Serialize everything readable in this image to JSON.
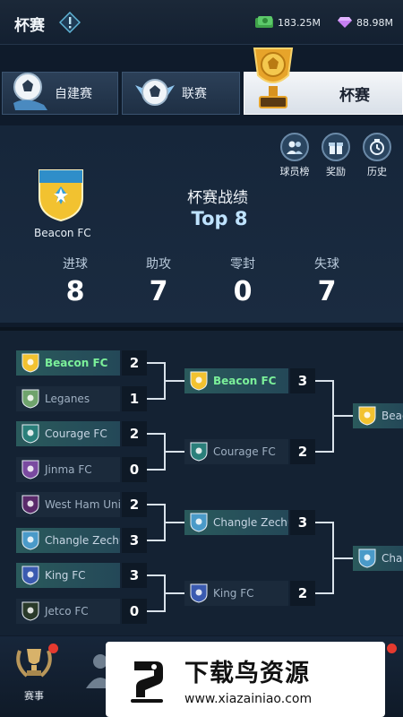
{
  "header": {
    "title": "杯赛",
    "money": "183.25M",
    "gems": "88.98M"
  },
  "tabs": [
    {
      "label": "自建赛",
      "icon": "ball-hand-icon"
    },
    {
      "label": "联赛",
      "icon": "ball-wings-icon"
    },
    {
      "label": "杯赛",
      "icon": "trophy-icon",
      "active": true
    }
  ],
  "quick_links": [
    {
      "label": "球员榜",
      "icon": "players-icon"
    },
    {
      "label": "奖励",
      "icon": "gift-icon"
    },
    {
      "label": "历史",
      "icon": "history-icon"
    }
  ],
  "record": {
    "team": "Beacon FC",
    "title": "杯赛战绩",
    "rank": "Top 8"
  },
  "stats": [
    {
      "label": "进球",
      "value": "8"
    },
    {
      "label": "助攻",
      "value": "7"
    },
    {
      "label": "零封",
      "value": "0"
    },
    {
      "label": "失球",
      "value": "7"
    }
  ],
  "bracket": {
    "round1": [
      {
        "team": "Beacon FC",
        "score": "2",
        "result": "win",
        "crest": "#f2c230"
      },
      {
        "team": "Leganes",
        "score": "1",
        "result": "lose",
        "crest": "#6fa36c"
      },
      {
        "team": "Courage FC",
        "score": "2",
        "result": "win",
        "crest": "#2a7f7a"
      },
      {
        "team": "Jinma FC",
        "score": "0",
        "result": "lose",
        "crest": "#7a4aa0"
      },
      {
        "team": "West Ham United",
        "score": "2",
        "result": "lose",
        "crest": "#5a2a6a"
      },
      {
        "team": "Changle Zechuan FC",
        "score": "3",
        "result": "win",
        "crest": "#4a9ac8"
      },
      {
        "team": "King FC",
        "score": "3",
        "result": "win",
        "crest": "#3a5ab0"
      },
      {
        "team": "Jetco FC",
        "score": "0",
        "result": "lose",
        "crest": "#2a3a2a"
      }
    ],
    "round2": [
      {
        "team": "Beacon FC",
        "score": "3",
        "result": "win",
        "crest": "#f2c230"
      },
      {
        "team": "Courage FC",
        "score": "2",
        "result": "lose",
        "crest": "#2a7f7a"
      },
      {
        "team": "Changle Zechuan FC",
        "score": "3",
        "result": "win",
        "crest": "#4a9ac8"
      },
      {
        "team": "King FC",
        "score": "2",
        "result": "lose",
        "crest": "#3a5ab0"
      }
    ],
    "round3": [
      {
        "team": "Beaco",
        "crest": "#f2c230"
      },
      {
        "team": "Changl",
        "crest": "#4a9ac8"
      }
    ]
  },
  "bottom_nav": {
    "tournament_label": "赛事"
  },
  "watermark": {
    "title": "下载鸟资源",
    "url": "www.xiazainiao.com"
  }
}
